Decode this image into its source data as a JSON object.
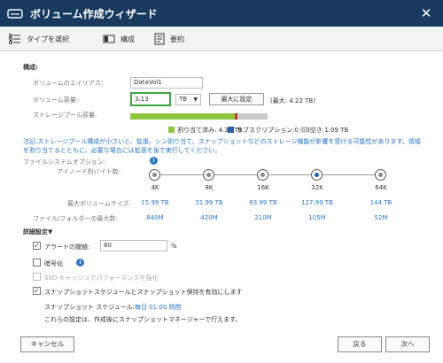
{
  "window": {
    "title": "ボリューム作成ウィザード",
    "close_icon": "close-icon"
  },
  "steps": [
    {
      "label": "タイプを選択",
      "icon": "list-icon"
    },
    {
      "label": "構成",
      "icon": "config-icon"
    },
    {
      "label": "要約",
      "icon": "summary-icon"
    }
  ],
  "config": {
    "section_title": "構成:",
    "alias_label": "ボリュームのエイリアス:",
    "alias_value": "DataVol1",
    "capacity_label": "ボリューム容量:",
    "capacity_value": "3.13",
    "unit_selected": "TB",
    "max_button": "最大に設定",
    "max_note": "(最大: 4.22 TB)",
    "pool_label": "ストレージプール容量:",
    "legend": {
      "allocated": "割り当て済み: 4.34 TB",
      "subscription": "サブスクリプション:0 MB",
      "free": "空き:1.09 TB"
    },
    "pool_fraction_allocated": 0.76,
    "pool_fraction_subscription": 0.02,
    "note": "注記:ストレージプール構成が小さいと、拡張、シン割り当て、スナップショットなどのストレージ機能が影響を受ける可能性があります。領域を割り当てるとともに、必要な場合には拡張を後で実行してください。"
  },
  "filesystem": {
    "label": "ファイルシステムオプション:",
    "inode_label": "アイノード別バイト数:",
    "max_volume_label": "最大ボリュームサイズ:",
    "max_files_label": "ファイル/フォルダーの最大数:",
    "options": [
      {
        "size": "4K",
        "max_volume": "15.99 TB",
        "max_files": "840M"
      },
      {
        "size": "8K",
        "max_volume": "31.99 TB",
        "max_files": "420M"
      },
      {
        "size": "16K",
        "max_volume": "63.99 TB",
        "max_files": "210M"
      },
      {
        "size": "32K",
        "max_volume": "127.99 TB",
        "max_files": "105M"
      },
      {
        "size": "64K",
        "max_volume": "144 TB",
        "max_files": "52M"
      }
    ],
    "selected_index": 3
  },
  "advanced": {
    "title": "詳細設定▼",
    "alert_label": "アラートの閾値:",
    "alert_value": "80",
    "alert_unit": "%",
    "encryption_label": "暗号化",
    "ssd_cache_label": "SSD キャッシュでパフォーマンスを強化",
    "snapshot_label": "スナップショットスケジュールとスナップショット保持を有効にします",
    "schedule_label": "スナップショット スケジュール:",
    "schedule_value": "毎日 01:00 時間",
    "schedule_note": "これらの設定は、作成後にスナップショットマネージャーで行えます。"
  },
  "footer": {
    "cancel": "キャンセル",
    "back": "戻る",
    "next": "次へ"
  },
  "colors": {
    "titlebar": "#173a5e",
    "allocated": "#8cc63f",
    "subscription": "#c0392b",
    "free": "#c9c9c9",
    "focus": "#3fa53f",
    "link": "#2a78c8"
  }
}
